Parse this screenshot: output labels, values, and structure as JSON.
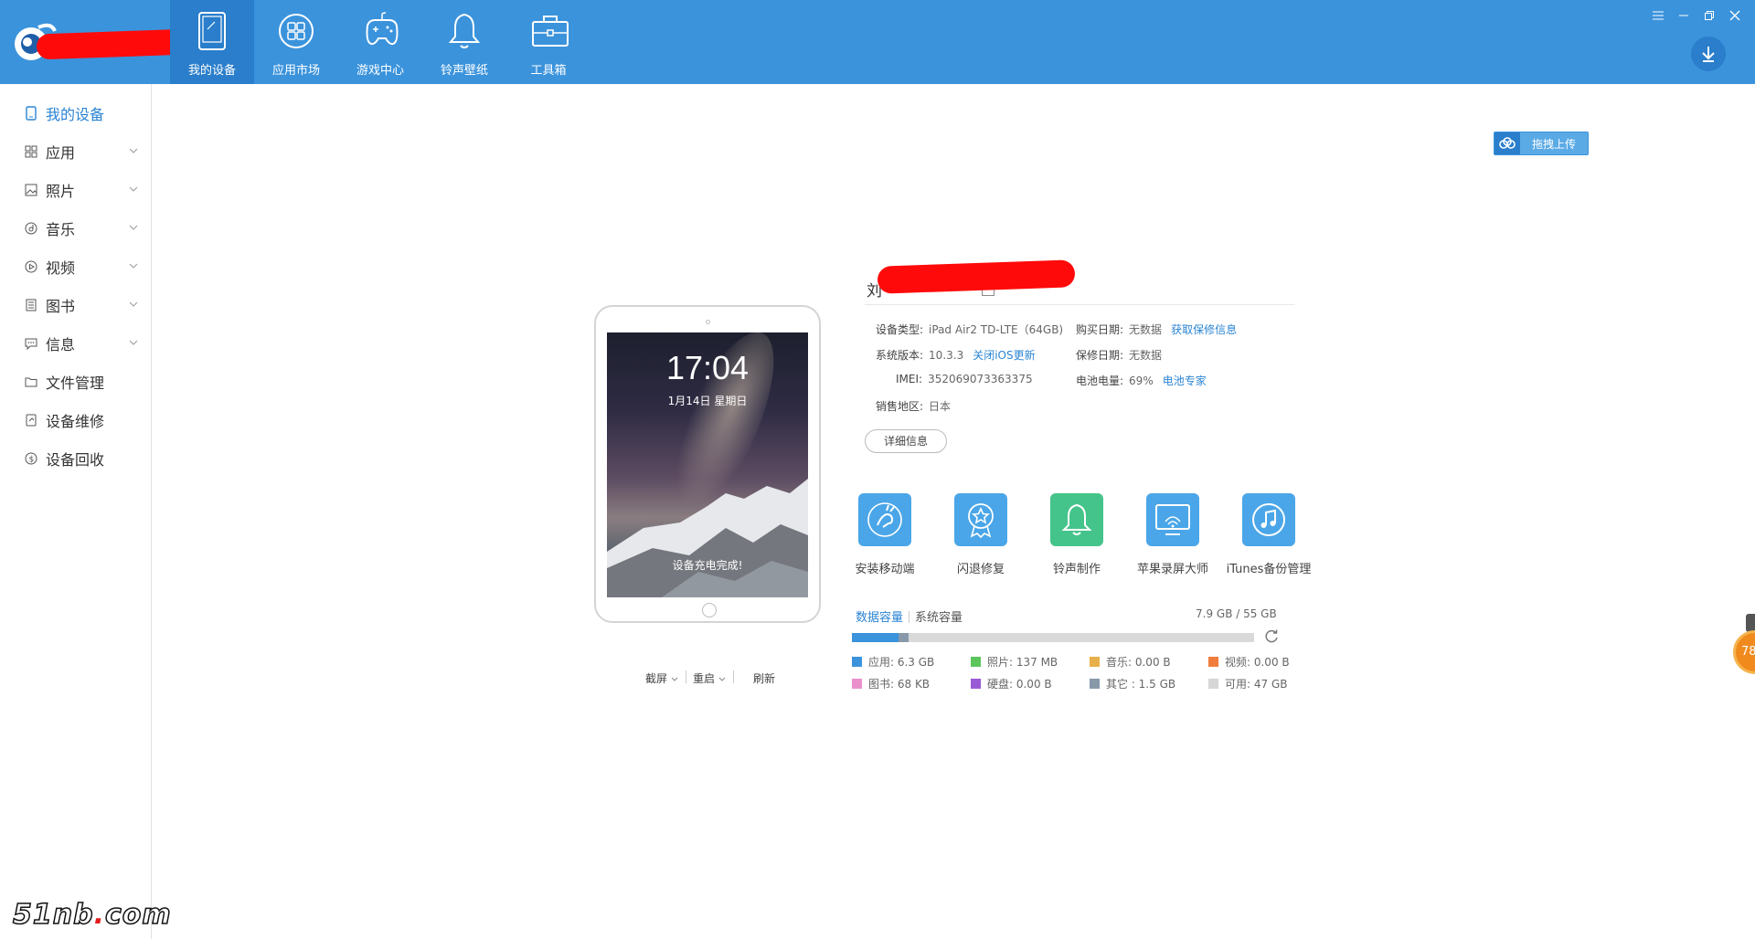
{
  "nav": {
    "tabs": [
      {
        "label": "我的设备"
      },
      {
        "label": "应用市场"
      },
      {
        "label": "游戏中心"
      },
      {
        "label": "铃声壁纸"
      },
      {
        "label": "工具箱"
      }
    ]
  },
  "sidebar": {
    "items": [
      {
        "label": "我的设备",
        "icon": "phone-icon"
      },
      {
        "label": "应用",
        "icon": "grid-icon"
      },
      {
        "label": "照片",
        "icon": "image-icon"
      },
      {
        "label": "音乐",
        "icon": "music-icon"
      },
      {
        "label": "视频",
        "icon": "video-icon"
      },
      {
        "label": "图书",
        "icon": "book-icon"
      },
      {
        "label": "信息",
        "icon": "message-icon"
      },
      {
        "label": "文件管理",
        "icon": "folder-icon"
      },
      {
        "label": "设备维修",
        "icon": "repair-icon"
      },
      {
        "label": "设备回收",
        "icon": "recycle-icon"
      }
    ]
  },
  "upload": {
    "label": "拖拽上传"
  },
  "device": {
    "lock_time": "17:04",
    "lock_date": "1月14日 星期日",
    "lock_status": "设备充电完成!",
    "actions": {
      "screenshot": "截屏",
      "restart": "重启",
      "refresh": "刷新"
    }
  },
  "info": {
    "name": "刘",
    "rows": {
      "type_k": "设备类型:",
      "type_v": "iPad Air2 TD-LTE（64GB)",
      "ver_k": "系统版本:",
      "ver_v": "10.3.3",
      "ver_link": "关闭iOS更新",
      "imei_k": "IMEI:",
      "imei_v": "352069073363375",
      "region_k": "销售地区:",
      "region_v": "日本",
      "buy_k": "购买日期:",
      "buy_v": "无数据",
      "buy_link": "获取保修信息",
      "warranty_k": "保修日期:",
      "warranty_v": "无数据",
      "battery_k": "电池电量:",
      "battery_v": "69%",
      "battery_link": "电池专家"
    },
    "detail_button": "详细信息"
  },
  "tools": [
    {
      "label": "安装移动端",
      "color": "#4aa6e8",
      "icon": "install-mobile-icon"
    },
    {
      "label": "闪退修复",
      "color": "#4aa6e8",
      "icon": "crash-fix-icon"
    },
    {
      "label": "铃声制作",
      "color": "#44c48a",
      "icon": "ringtone-icon"
    },
    {
      "label": "苹果录屏大师",
      "color": "#4aa6e8",
      "icon": "screen-record-icon"
    },
    {
      "label": "iTunes备份管理",
      "color": "#4aa6e8",
      "icon": "itunes-backup-icon"
    }
  ],
  "storage": {
    "tab_data": "数据容量",
    "tab_system": "系统容量",
    "total": "7.9 GB / 55 GB",
    "used_fraction_apps": 0.115,
    "used_fraction_other": 0.027,
    "legend": [
      {
        "label": "应用: 6.3 GB",
        "color": "#3b93dc"
      },
      {
        "label": "照片: 137 MB",
        "color": "#5cc65c"
      },
      {
        "label": "音乐: 0.00 B",
        "color": "#e8b04a"
      },
      {
        "label": "视频: 0.00 B",
        "color": "#f07d3c"
      },
      {
        "label": "图书: 68 KB",
        "color": "#ea90cc"
      },
      {
        "label": "硬盘: 0.00 B",
        "color": "#9a5bd6"
      },
      {
        "label": "其它 : 1.5 GB",
        "color": "#8899aa"
      },
      {
        "label": "可用: 47 GB",
        "color": "#d6d6d6"
      }
    ]
  },
  "badge": {
    "text": "78"
  },
  "watermark": {
    "pre": "51nb",
    "dot": ".",
    "post": "com"
  }
}
